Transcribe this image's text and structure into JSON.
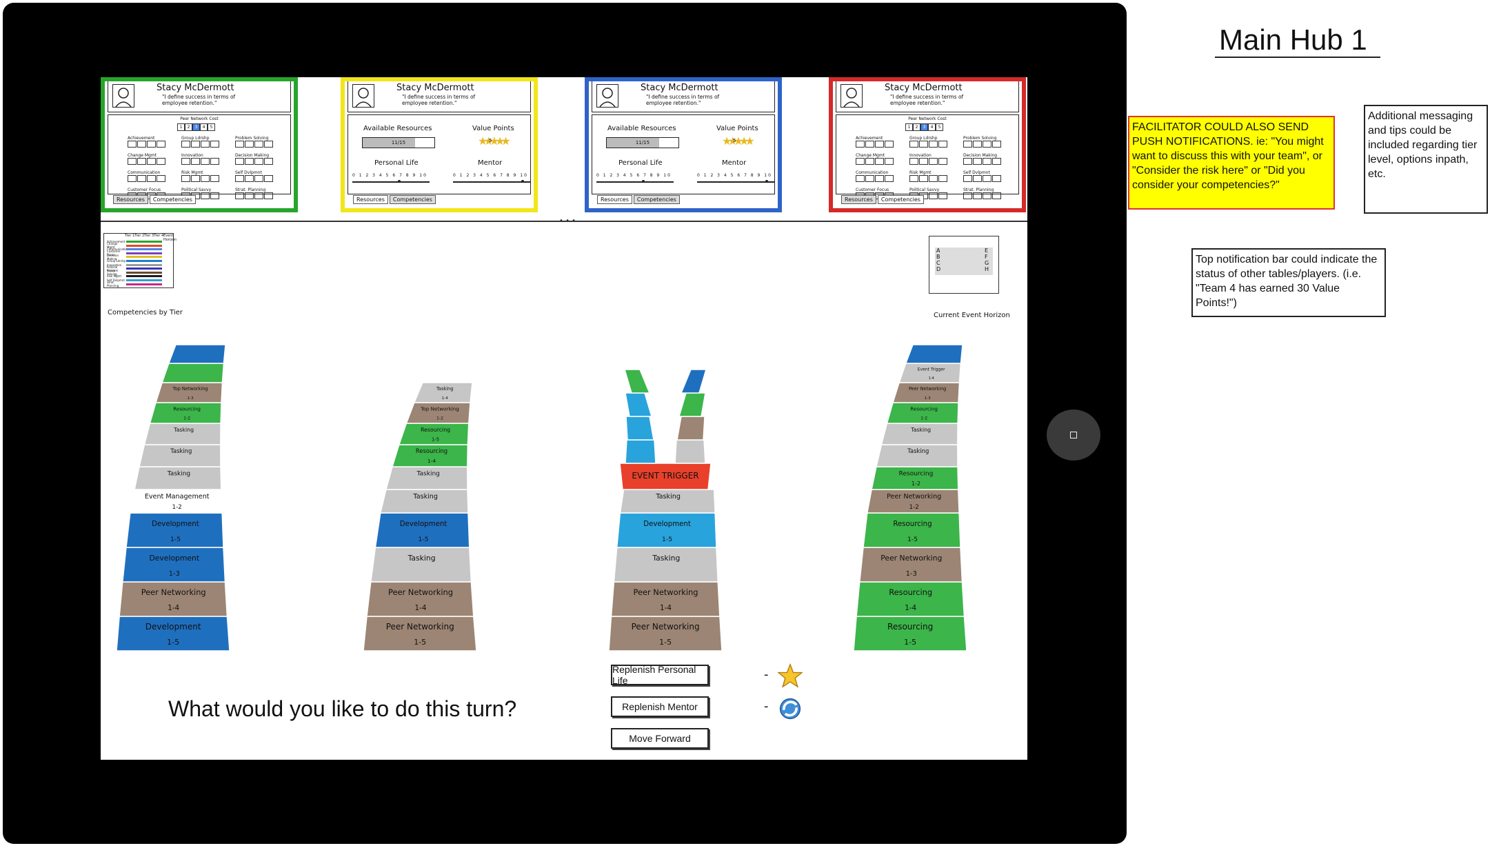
{
  "title": "Main Hub 1",
  "notes": {
    "facilitator": "FACILITATOR COULD ALSO SEND PUSH NOTIFICATIONS. ie: \"You might want to discuss this with your team\", or \"Consider the risk here\" or \"Did you consider your competencies?\"",
    "messaging": "Additional messaging and tips could be included regarding tier level, options inpath, etc.",
    "notification_bar": "Top notification bar could indicate the status of other tables/players. (i.e. \"Team 4 has earned 30 Value Points!\")"
  },
  "player_cards": [
    {
      "color": "#27a52b",
      "name": "Stacy McDermott",
      "quote": "\"I define success in terms of employee retention.\"",
      "active_tab": "competencies",
      "tabs": {
        "resources": "Resources",
        "competencies": "Competencies"
      },
      "peer_network_cost_label": "Peer Network Cost",
      "peer_scale": [
        "1",
        "2",
        "3",
        "4",
        "5"
      ],
      "peer_selected": 3,
      "competencies": [
        "Achievement",
        "Group Ldrshp",
        "Problem Solving",
        "Change Mgmt",
        "Innovation",
        "Decision Making",
        "Communication",
        "Risk Mgmt",
        "Self Dvlpmnt",
        "Customer Focus",
        "Political Savvy",
        "Strat. Planning"
      ]
    },
    {
      "color": "#f1e61a",
      "name": "Stacy McDermott",
      "quote": "\"I define success in terms of employee retention.\"",
      "active_tab": "resources",
      "tabs": {
        "resources": "Resources",
        "competencies": "Competencies"
      },
      "available_resources_label": "Available Resources",
      "available_resources_value": "11/15",
      "available_resources_fraction": 0.73,
      "value_points_label": "Value Points",
      "value_points_value": "5",
      "personal_life_label": "Personal Life",
      "mentor_label": "Mentor",
      "scale": "0 1 2 3 4 5 6 7 8 9 10",
      "personal_life_level": 6,
      "mentor_level": 9
    },
    {
      "color": "#2f63c8",
      "name": "Stacy McDermott",
      "quote": "\"I define success in terms of employee retention.\"",
      "active_tab": "resources",
      "tabs": {
        "resources": "Resources",
        "competencies": "Competencies"
      },
      "available_resources_label": "Available Resources",
      "available_resources_value": "11/15",
      "available_resources_fraction": 0.73,
      "value_points_label": "Value Points",
      "value_points_value": "5",
      "personal_life_label": "Personal Life",
      "mentor_label": "Mentor",
      "scale": "0 1 2 3 4 5 6 7 8 9 10",
      "personal_life_level": 6,
      "mentor_level": 9
    },
    {
      "color": "#d42a2a",
      "name": "Stacy McDermott",
      "quote": "\"I define success in terms of employee retention.\"",
      "active_tab": "competencies",
      "tabs": {
        "resources": "Resources",
        "competencies": "Competencies"
      },
      "peer_network_cost_label": "Peer Network Cost",
      "peer_scale": [
        "1",
        "2",
        "3",
        "4",
        "5"
      ],
      "peer_selected": 3,
      "competencies": [
        "Achievement",
        "Group Ldrshp",
        "Problem Solving",
        "Change Mgmt",
        "Innovation",
        "Decision Making",
        "Communication",
        "Risk Mgmt",
        "Self Dvlpmnt",
        "Customer Focus",
        "Political Savvy",
        "Strat. Planning"
      ]
    }
  ],
  "competencies_by_tier": {
    "caption": "Competencies by Tier",
    "headers": [
      "Tier 1",
      "Tier 2",
      "Tier 3",
      "Tier 4",
      "Event Horizon"
    ],
    "rows": [
      {
        "label": "Achievement",
        "color": "#27a52b"
      },
      {
        "label": "Change Mgmt",
        "color": "#e04a2a"
      },
      {
        "label": "Communication",
        "color": "#4a86e8"
      },
      {
        "label": "Customer Focus",
        "color": "#7b3fbf"
      },
      {
        "label": "Decision Making",
        "color": "#e0c020"
      },
      {
        "label": "Group Ldrshp",
        "color": "#1f7fd0"
      },
      {
        "label": "Innovation",
        "color": "#9a9a9a"
      },
      {
        "label": "Political Savvy",
        "color": "#3a2fbf"
      },
      {
        "label": "Problem Solving",
        "color": "#6b4a2a"
      },
      {
        "label": "Risk Mgmt",
        "color": "#1a1a1a"
      },
      {
        "label": "Self Dvlpmnt",
        "color": "#2fa0d0"
      },
      {
        "label": "Strat. Planning",
        "color": "#c02a8a"
      }
    ]
  },
  "event_horizon": {
    "caption": "Current Event Horizon",
    "left_letters": [
      "A",
      "B",
      "C",
      "D"
    ],
    "right_letters": [
      "E",
      "F",
      "G",
      "H"
    ]
  },
  "towers": [
    {
      "name": "green-team",
      "segments": [
        {
          "label": "Development",
          "sub": "1-5",
          "color": "#1f6fbf"
        },
        {
          "label": "Peer Networking",
          "sub": "1-4",
          "color": "#9c8574"
        },
        {
          "label": "Development",
          "sub": "1-3",
          "color": "#1f6fbf"
        },
        {
          "label": "Development",
          "sub": "1-5",
          "color": "#1f6fbf"
        },
        {
          "label": "Event Management",
          "sub": "1-2",
          "color": "#ffffff"
        },
        {
          "label": "Tasking",
          "sub": "",
          "color": "#c6c6c6"
        },
        {
          "label": "Tasking",
          "sub": "",
          "color": "#c6c6c6"
        },
        {
          "label": "Tasking",
          "sub": "",
          "color": "#c6c6c6"
        },
        {
          "label": "Resourcing",
          "sub": "1-2",
          "color": "#3cb54a"
        },
        {
          "label": "Top Networking",
          "sub": "1-3",
          "color": "#9c8574"
        },
        {
          "label": "",
          "sub": "",
          "color": "#3cb54a"
        },
        {
          "label": "",
          "sub": "",
          "color": "#1f6fbf"
        }
      ]
    },
    {
      "name": "yellow-team",
      "segments": [
        {
          "label": "Peer Networking",
          "sub": "1-5",
          "color": "#9c8574"
        },
        {
          "label": "Peer Networking",
          "sub": "1-4",
          "color": "#9c8574"
        },
        {
          "label": "Tasking",
          "sub": "",
          "color": "#c6c6c6"
        },
        {
          "label": "Development",
          "sub": "1-5",
          "color": "#1f6fbf"
        },
        {
          "label": "Tasking",
          "sub": "",
          "color": "#c6c6c6"
        },
        {
          "label": "Tasking",
          "sub": "",
          "color": "#c6c6c6"
        },
        {
          "label": "Resourcing",
          "sub": "1-4",
          "color": "#3cb54a"
        },
        {
          "label": "Resourcing",
          "sub": "1-5",
          "color": "#3cb54a"
        },
        {
          "label": "Top Networking",
          "sub": "1-2",
          "color": "#9c8574"
        },
        {
          "label": "Tasking",
          "sub": "1-4",
          "color": "#c6c6c6"
        }
      ]
    },
    {
      "name": "blue-team",
      "event_label": "EVENT TRIGGER",
      "segments": [
        {
          "label": "Peer Networking",
          "sub": "1-5",
          "color": "#9c8574"
        },
        {
          "label": "Peer Networking",
          "sub": "1-4",
          "color": "#9c8574"
        },
        {
          "label": "Tasking",
          "sub": "",
          "color": "#c6c6c6"
        },
        {
          "label": "Development",
          "sub": "1-5",
          "color": "#29a3dc"
        },
        {
          "label": "Tasking",
          "sub": "",
          "color": "#c6c6c6"
        }
      ]
    },
    {
      "name": "red-team",
      "segments": [
        {
          "label": "Resourcing",
          "sub": "1-5",
          "color": "#3cb54a"
        },
        {
          "label": "Resourcing",
          "sub": "1-4",
          "color": "#3cb54a"
        },
        {
          "label": "Peer Networking",
          "sub": "1-3",
          "color": "#9c8574"
        },
        {
          "label": "Resourcing",
          "sub": "1-5",
          "color": "#3cb54a"
        },
        {
          "label": "Peer Networking",
          "sub": "1-2",
          "color": "#9c8574"
        },
        {
          "label": "Resourcing",
          "sub": "1-2",
          "color": "#3cb54a"
        },
        {
          "label": "Tasking",
          "sub": "",
          "color": "#c6c6c6"
        },
        {
          "label": "Tasking",
          "sub": "",
          "color": "#c6c6c6"
        },
        {
          "label": "Resourcing",
          "sub": "1-2",
          "color": "#3cb54a"
        },
        {
          "label": "Peer Networking",
          "sub": "1-3",
          "color": "#9c8574"
        },
        {
          "label": "Event Trigger",
          "sub": "1-4",
          "color": "#c6c6c6"
        },
        {
          "label": "",
          "sub": "",
          "color": "#1f6fbf"
        }
      ]
    }
  ],
  "turn": {
    "prompt": "What would you like to do this turn?",
    "replenish_personal_life": "Replenish Personal Life",
    "replenish_mentor": "Replenish Mentor",
    "move_forward": "Move Forward",
    "dash": "-"
  },
  "icons": {
    "personal_life": "star-icon",
    "mentor": "refresh-orb-icon",
    "home": "home-button-icon"
  }
}
